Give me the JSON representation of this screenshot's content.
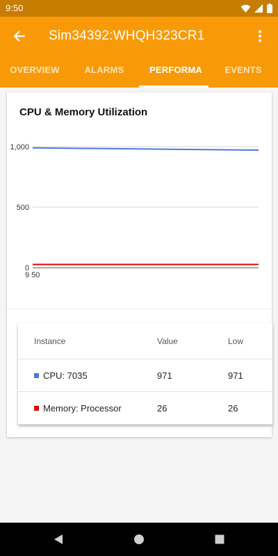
{
  "status_bar": {
    "time": "9:50",
    "icons": [
      "wifi-icon",
      "signal-icon",
      "battery-icon"
    ]
  },
  "app_bar": {
    "title": "Sim34392:WHQH323CR1"
  },
  "tabs": [
    {
      "label": "OVERVIEW",
      "active": false
    },
    {
      "label": "ALARMS",
      "active": false
    },
    {
      "label": "PERFORMA",
      "active": true
    },
    {
      "label": "EVENTS",
      "active": false
    }
  ],
  "card": {
    "title": "CPU & Memory Utilization"
  },
  "chart_data": {
    "type": "line",
    "ylim": [
      0,
      1000
    ],
    "y_ticks": [
      "1,000",
      "500",
      "0"
    ],
    "x_tick_labels": [
      "9 50"
    ],
    "grid": true,
    "series": [
      {
        "name": "CPU: 7035",
        "color": "#4a78dc",
        "values": [
          990,
          971
        ]
      },
      {
        "name": "Memory: Processor",
        "color": "#e00000",
        "values": [
          26,
          26
        ]
      }
    ]
  },
  "table": {
    "headers": [
      "Instance",
      "Value",
      "Low"
    ],
    "rows": [
      {
        "instance": "CPU: 7035",
        "color": "#4a78dc",
        "value": "971",
        "low": "971"
      },
      {
        "instance": "Memory: Processor",
        "color": "#e00000",
        "value": "26",
        "low": "26"
      }
    ]
  },
  "colors": {
    "accent": "#f89a08",
    "status_bar": "#c77c02"
  }
}
